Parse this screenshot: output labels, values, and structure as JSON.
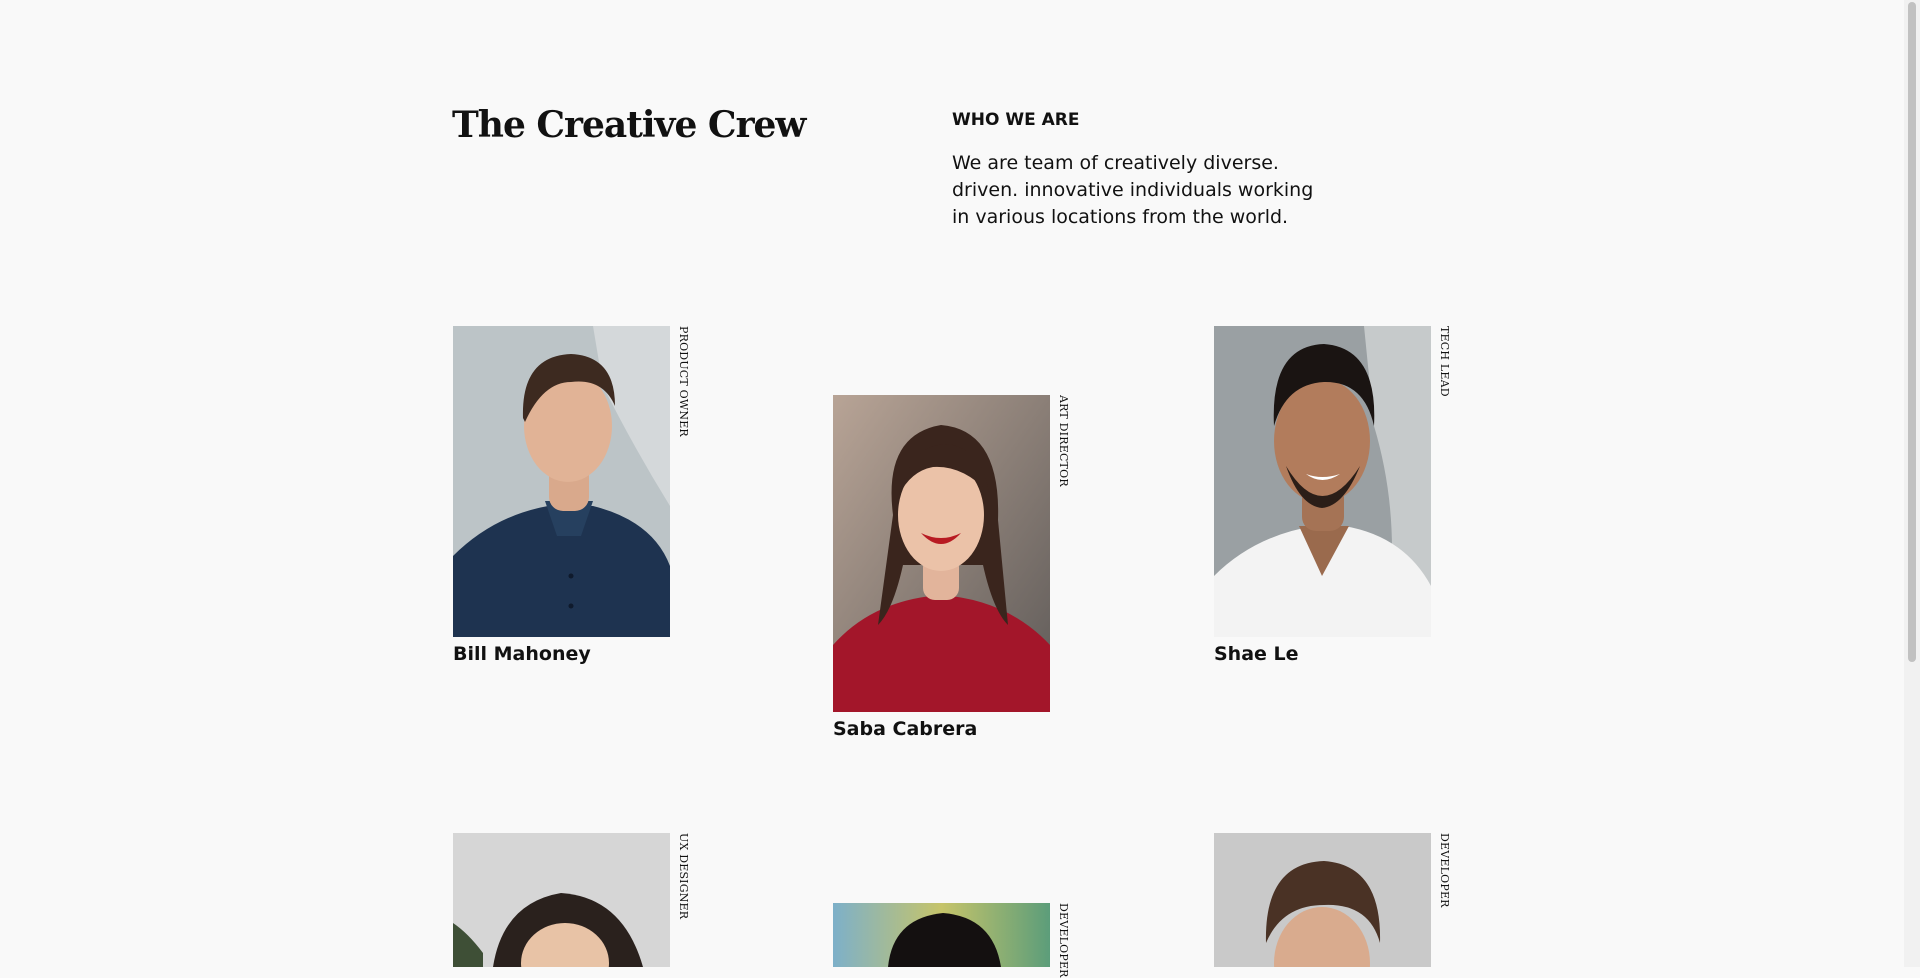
{
  "header": {
    "title": "The Creative Crew",
    "who_heading": "WHO WE ARE",
    "description": "We are team of creatively diverse. driven. innovative individuals working in various locations from the world."
  },
  "team": [
    {
      "name": "Bill Mahoney",
      "role": "Product Owner"
    },
    {
      "name": "Saba Cabrera",
      "role": "Art Director"
    },
    {
      "name": "Shae Le",
      "role": "Tech Lead"
    },
    {
      "name": "",
      "role": "UX Designer"
    },
    {
      "name": "",
      "role": "Developer"
    },
    {
      "name": "",
      "role": "Developer"
    }
  ],
  "colors": {
    "background": "#f9f9f9",
    "text": "#111111"
  }
}
